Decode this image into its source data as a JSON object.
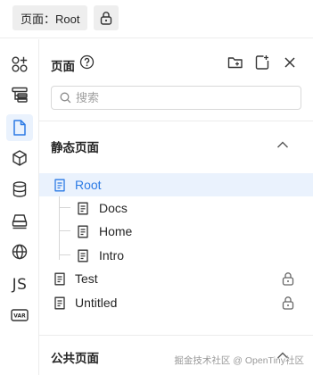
{
  "topbar": {
    "page_label": "页面：Root"
  },
  "sidebar": {
    "items": [
      {
        "name": "components",
        "icon": "components-icon"
      },
      {
        "name": "outline",
        "icon": "outline-icon"
      },
      {
        "name": "pages",
        "icon": "page-icon",
        "active": true
      },
      {
        "name": "blocks",
        "icon": "cube-icon"
      },
      {
        "name": "data-source",
        "icon": "database-icon"
      },
      {
        "name": "bridge",
        "icon": "bridge-icon"
      },
      {
        "name": "i18n",
        "icon": "globe-icon"
      },
      {
        "name": "script",
        "label": "JS"
      },
      {
        "name": "variables",
        "label": "VAR"
      }
    ]
  },
  "panel": {
    "title": "页面",
    "search_placeholder": "搜索",
    "static_section": {
      "title": "静态页面",
      "expanded": true,
      "pages": [
        {
          "label": "Root",
          "level": 0,
          "selected": true,
          "locked": false
        },
        {
          "label": "Docs",
          "level": 1,
          "selected": false,
          "locked": false
        },
        {
          "label": "Home",
          "level": 1,
          "selected": false,
          "locked": false
        },
        {
          "label": "Intro",
          "level": 1,
          "selected": false,
          "locked": false
        },
        {
          "label": "Test",
          "level": 0,
          "selected": false,
          "locked": true
        },
        {
          "label": "Untitled",
          "level": 0,
          "selected": false,
          "locked": true
        }
      ]
    },
    "public_section": {
      "title": "公共页面"
    }
  },
  "watermark": "掘金技术社区 @ OpenTiny社区",
  "colors": {
    "accent": "#2c7be5",
    "selected_bg": "#eaf2fd",
    "border": "#ececec"
  }
}
